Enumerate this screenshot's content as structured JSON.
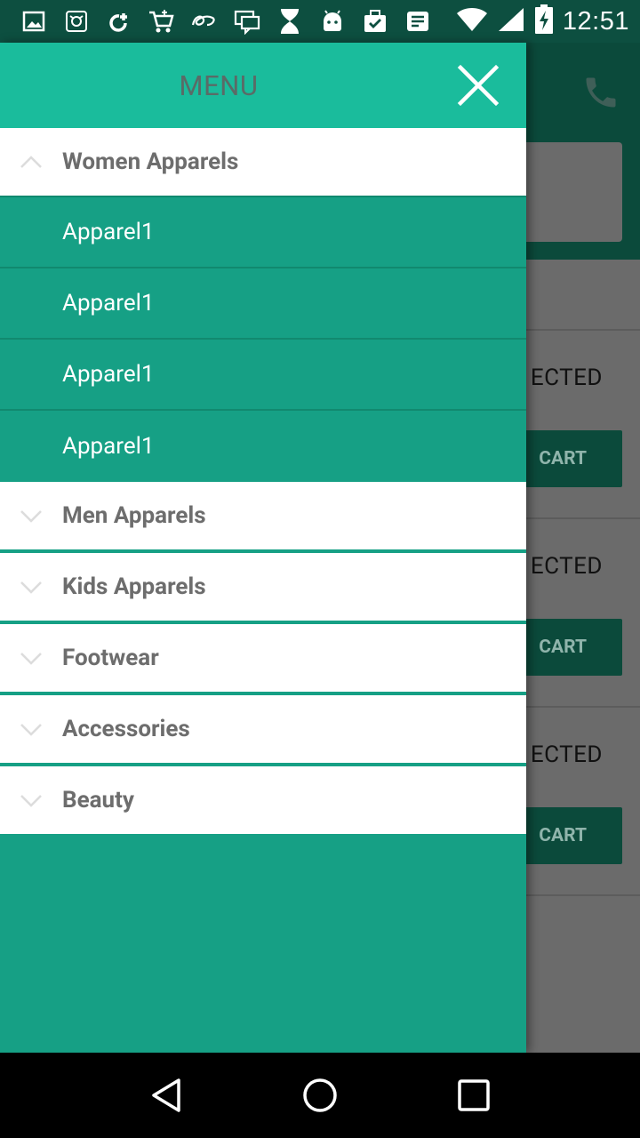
{
  "status_bar": {
    "time": "12:51",
    "icons": [
      "gallery-icon",
      "shopping-bag-icon",
      "refresh-plus-icon",
      "cart-icon",
      "alibaba-icon",
      "chat-icon",
      "hourglass-icon",
      "android-icon",
      "checklist-icon",
      "message-icon",
      "wifi-icon",
      "signal-icon",
      "battery-charging-icon"
    ]
  },
  "drawer": {
    "title": "MENU",
    "groups": [
      {
        "label": "Women Apparels",
        "expanded": true,
        "items": [
          "Apparel1",
          "Apparel1",
          "Apparel1",
          "Apparel1"
        ]
      },
      {
        "label": "Men Apparels",
        "expanded": false
      },
      {
        "label": "Kids Apparels",
        "expanded": false
      },
      {
        "label": "Footwear",
        "expanded": false
      },
      {
        "label": "Accessories",
        "expanded": false
      },
      {
        "label": "Beauty",
        "expanded": false
      }
    ]
  },
  "background_app": {
    "rows": [
      {
        "label": "ECTED",
        "button": "CART"
      },
      {
        "label": "ECTED",
        "button": "CART"
      },
      {
        "label": "ECTED",
        "button": "CART"
      }
    ]
  },
  "colors": {
    "drawer_bg": "#16a085",
    "drawer_header": "#1abc9c",
    "status_bar": "#0d4f40"
  }
}
